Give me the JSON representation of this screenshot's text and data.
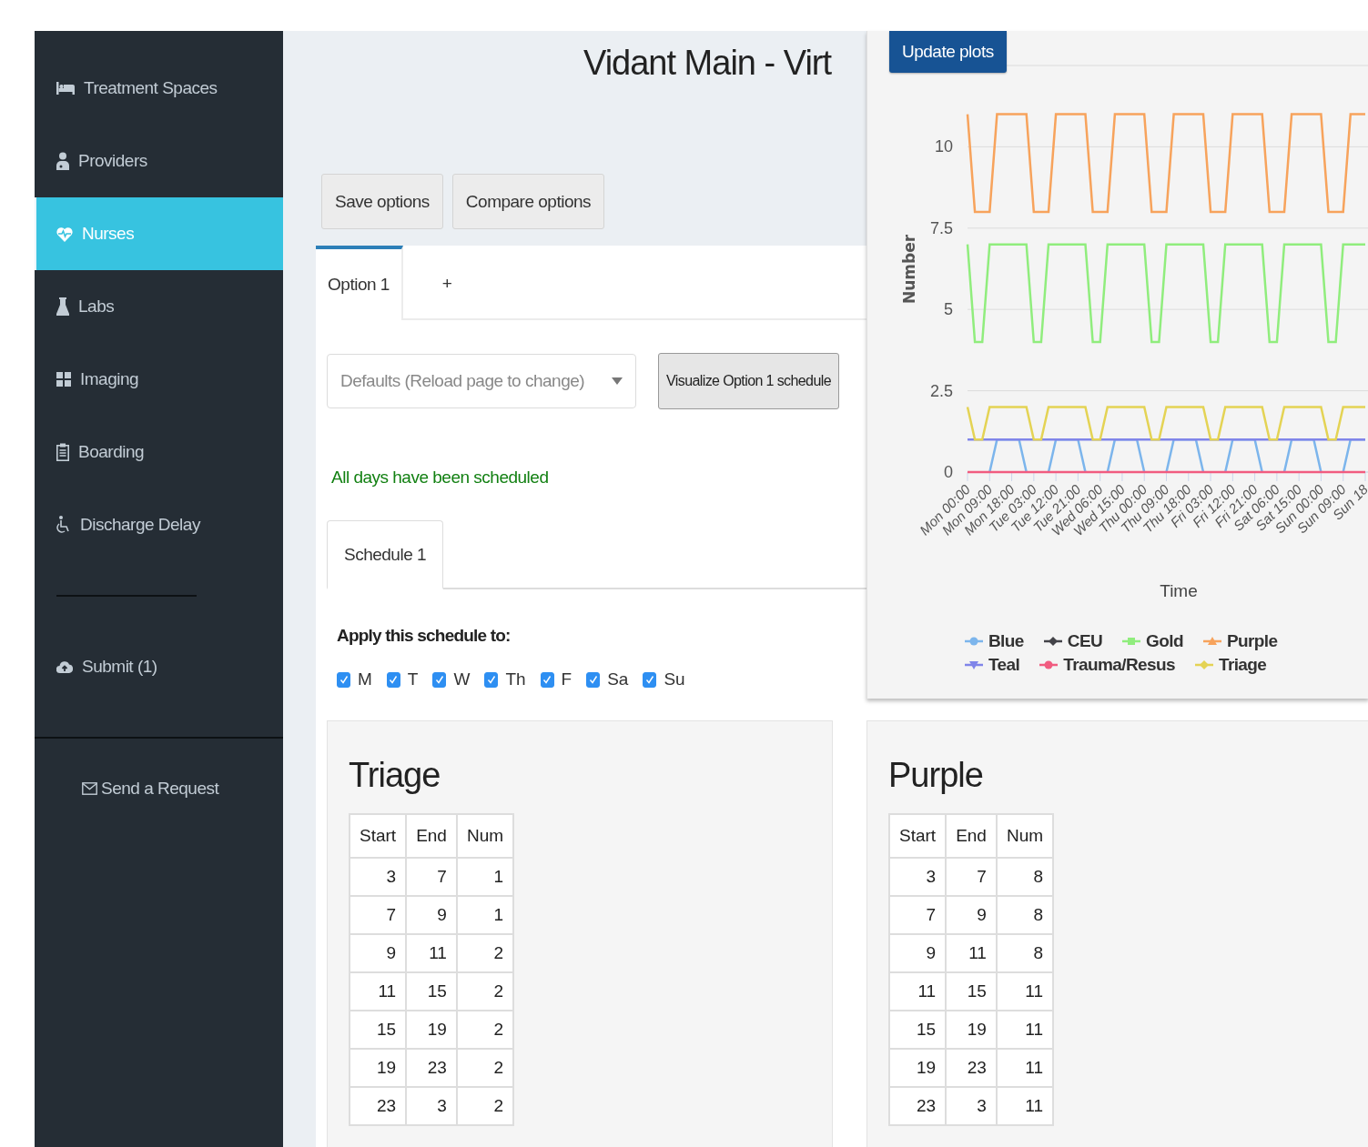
{
  "sidebar": {
    "items": [
      {
        "label": "Treatment Spaces",
        "selected": false
      },
      {
        "label": "Providers",
        "selected": false
      },
      {
        "label": "Nurses",
        "selected": true
      },
      {
        "label": "Labs",
        "selected": false
      },
      {
        "label": "Imaging",
        "selected": false
      },
      {
        "label": "Boarding",
        "selected": false
      },
      {
        "label": "Discharge Delay",
        "selected": false
      }
    ],
    "submit": "Submit (1)",
    "request_link": "Send a Request"
  },
  "title": "Vidant Main - Virt",
  "toolbar": [
    "Save options",
    "Compare options"
  ],
  "option_tabs": [
    {
      "label": "Option 1",
      "selected": true
    },
    {
      "label": "+",
      "selected": false
    }
  ],
  "defaults_select": {
    "placeholder": "Defaults (Reload page to change)"
  },
  "visualize_button": "Visualize Option 1 schedule",
  "status_message": "All days have been scheduled",
  "schedule_tabs": [
    {
      "label": "Schedule 1",
      "selected": true
    }
  ],
  "apply_label": "Apply this schedule to:",
  "days": [
    {
      "label": "M",
      "checked": true
    },
    {
      "label": "T",
      "checked": true
    },
    {
      "label": "W",
      "checked": true
    },
    {
      "label": "Th",
      "checked": true
    },
    {
      "label": "F",
      "checked": true
    },
    {
      "label": "Sa",
      "checked": true
    },
    {
      "label": "Su",
      "checked": true
    }
  ],
  "tables": [
    {
      "title": "Triage",
      "columns": [
        "Start",
        "End",
        "Num"
      ],
      "rows": [
        [
          "3",
          "7",
          "1"
        ],
        [
          "7",
          "9",
          "1"
        ],
        [
          "9",
          "11",
          "2"
        ],
        [
          "11",
          "15",
          "2"
        ],
        [
          "15",
          "19",
          "2"
        ],
        [
          "19",
          "23",
          "2"
        ],
        [
          "23",
          "3",
          "2"
        ]
      ]
    },
    {
      "title": "Purple",
      "columns": [
        "Start",
        "End",
        "Num"
      ],
      "rows": [
        [
          "3",
          "7",
          "8"
        ],
        [
          "7",
          "9",
          "8"
        ],
        [
          "9",
          "11",
          "8"
        ],
        [
          "11",
          "15",
          "11"
        ],
        [
          "15",
          "19",
          "11"
        ],
        [
          "19",
          "23",
          "11"
        ],
        [
          "23",
          "3",
          "11"
        ]
      ]
    }
  ],
  "plot_panel": {
    "update_button": "Update plots",
    "chart_data": {
      "type": "line",
      "grid": true,
      "legend": true,
      "xlabel": "Time",
      "ylabel": "Number",
      "ylim": [
        0,
        12.5
      ],
      "yticks": [
        0,
        2.5,
        5,
        7.5,
        10
      ],
      "categories": [
        "Mon 00:00",
        null,
        null,
        "Mon 09:00",
        null,
        null,
        "Mon 18:00",
        null,
        null,
        "Tue 03:00",
        null,
        null,
        "Tue 12:00",
        null,
        null,
        "Tue 21:00",
        null,
        null,
        "Wed 06:00",
        null,
        null,
        "Wed 15:00",
        null,
        null,
        "Thu 00:00",
        null,
        null,
        "Thu 09:00",
        null,
        null,
        "Thu 18:00",
        null,
        null,
        "Fri 03:00",
        null,
        null,
        "Fri 12:00",
        null,
        null,
        "Fri 21:00",
        null,
        null,
        "Sat 06:00",
        null,
        null,
        "Sat 15:00",
        null,
        null,
        "Sun 00:00",
        null,
        null,
        "Sun 09:00",
        null,
        null,
        "Sun 18"
      ],
      "series": [
        {
          "name": "Blue",
          "color": "#7cb5ec",
          "values": [
            null,
            null,
            null,
            0,
            1,
            1,
            1,
            1,
            0,
            null,
            null,
            0,
            1,
            1,
            1,
            1,
            0,
            null,
            null,
            0,
            1,
            1,
            1,
            1,
            0,
            null,
            null,
            0,
            1,
            1,
            1,
            1,
            0,
            null,
            null,
            0,
            1,
            1,
            1,
            1,
            0,
            null,
            null,
            0,
            1,
            1,
            1,
            1,
            0,
            null,
            null,
            0,
            1,
            1,
            1
          ]
        },
        {
          "name": "CEU",
          "color": "#434348",
          "values": [
            null,
            null,
            null,
            null,
            null,
            null,
            null,
            null,
            null,
            null,
            null,
            null,
            null,
            null,
            null,
            null,
            null,
            null,
            null,
            null,
            null,
            null,
            null,
            null,
            null,
            null,
            null,
            null,
            null,
            null,
            null,
            null,
            null,
            null,
            null,
            null,
            null,
            null,
            null,
            null,
            null,
            null,
            null,
            null,
            null,
            null,
            null,
            null,
            null,
            null,
            null,
            null,
            null,
            null,
            null
          ]
        },
        {
          "name": "Gold",
          "color": "#90ed7d",
          "values": [
            7,
            4,
            4,
            7,
            7,
            7,
            7,
            7,
            7,
            4,
            4,
            7,
            7,
            7,
            7,
            7,
            7,
            4,
            4,
            7,
            7,
            7,
            7,
            7,
            7,
            4,
            4,
            7,
            7,
            7,
            7,
            7,
            7,
            4,
            4,
            7,
            7,
            7,
            7,
            7,
            7,
            4,
            4,
            7,
            7,
            7,
            7,
            7,
            7,
            4,
            4,
            7,
            7,
            7,
            7
          ]
        },
        {
          "name": "Purple",
          "color": "#f7a35c",
          "values": [
            11,
            8,
            8,
            8,
            11,
            11,
            11,
            11,
            11,
            8,
            8,
            8,
            11,
            11,
            11,
            11,
            11,
            8,
            8,
            8,
            11,
            11,
            11,
            11,
            11,
            8,
            8,
            8,
            11,
            11,
            11,
            11,
            11,
            8,
            8,
            8,
            11,
            11,
            11,
            11,
            11,
            8,
            8,
            8,
            11,
            11,
            11,
            11,
            11,
            8,
            8,
            8,
            11,
            11,
            11
          ]
        },
        {
          "name": "Teal",
          "color": "#8085e9",
          "values": [
            1,
            1,
            1,
            1,
            1,
            1,
            1,
            1,
            1,
            1,
            1,
            1,
            1,
            1,
            1,
            1,
            1,
            1,
            1,
            1,
            1,
            1,
            1,
            1,
            1,
            1,
            1,
            1,
            1,
            1,
            1,
            1,
            1,
            1,
            1,
            1,
            1,
            1,
            1,
            1,
            1,
            1,
            1,
            1,
            1,
            1,
            1,
            1,
            1,
            1,
            1,
            1,
            1,
            1,
            1
          ]
        },
        {
          "name": "Trauma/Resus",
          "color": "#f15c80",
          "values": [
            0,
            0,
            0,
            0,
            0,
            0,
            0,
            0,
            0,
            0,
            0,
            0,
            0,
            0,
            0,
            0,
            0,
            0,
            0,
            0,
            0,
            0,
            0,
            0,
            0,
            0,
            0,
            0,
            0,
            0,
            0,
            0,
            0,
            0,
            0,
            0,
            0,
            0,
            0,
            0,
            0,
            0,
            0,
            0,
            0,
            0,
            0,
            0,
            0,
            0,
            0,
            0,
            0,
            0,
            0
          ]
        },
        {
          "name": "Triage",
          "color": "#e4d354",
          "values": [
            2,
            1,
            1,
            2,
            2,
            2,
            2,
            2,
            2,
            1,
            1,
            2,
            2,
            2,
            2,
            2,
            2,
            1,
            1,
            2,
            2,
            2,
            2,
            2,
            2,
            1,
            1,
            2,
            2,
            2,
            2,
            2,
            2,
            1,
            1,
            2,
            2,
            2,
            2,
            2,
            2,
            1,
            1,
            2,
            2,
            2,
            2,
            2,
            2,
            1,
            1,
            2,
            2,
            2,
            2
          ]
        }
      ]
    }
  }
}
